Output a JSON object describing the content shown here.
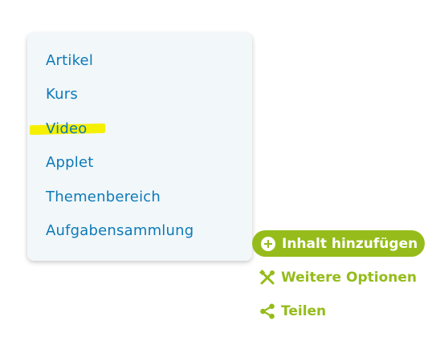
{
  "menu": {
    "items": [
      {
        "label": "Artikel"
      },
      {
        "label": "Kurs"
      },
      {
        "label": "Video"
      },
      {
        "label": "Applet"
      },
      {
        "label": "Themenbereich"
      },
      {
        "label": "Aufgabensammlung"
      }
    ]
  },
  "actions": {
    "add_content_label": "Inhalt hinzufügen",
    "more_options_label": "Weitere Optionen",
    "share_label": "Teilen"
  },
  "colors": {
    "link_blue": "#0c7ab8",
    "accent_green": "#95bc1a",
    "highlight_yellow": "#f5f000",
    "dropdown_bg": "#f2f7fa"
  },
  "icons": {
    "plus": "plus-circle-icon",
    "tools": "tools-icon",
    "share": "share-icon"
  }
}
